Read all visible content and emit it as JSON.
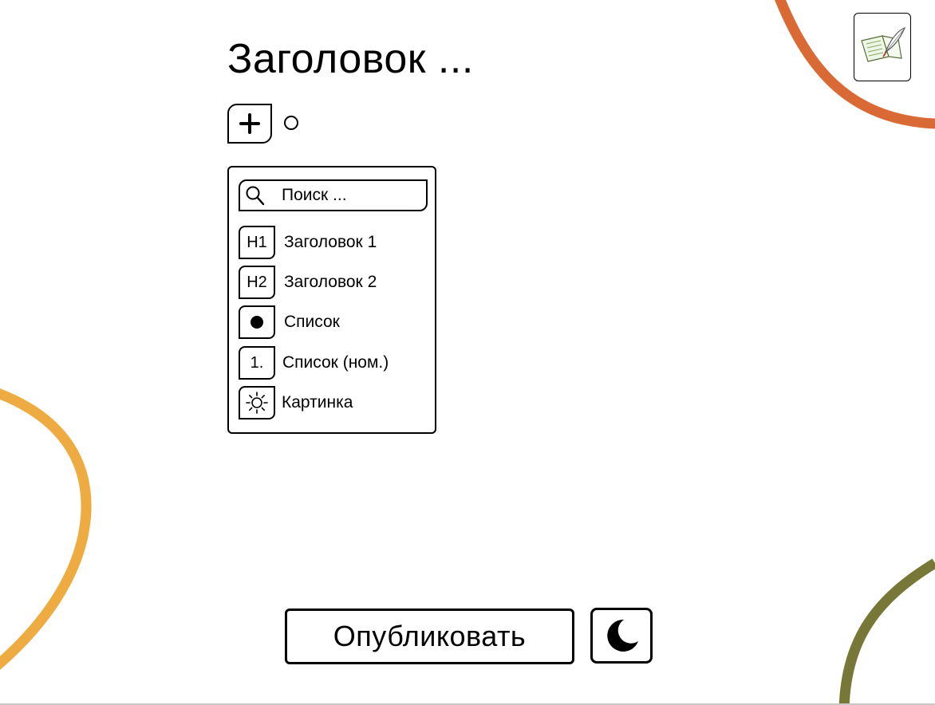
{
  "page": {
    "title": "Заголовок ..."
  },
  "toolbar": {
    "add_icon": "plus-icon",
    "status_icon": "circle-icon"
  },
  "block_menu": {
    "search": {
      "placeholder": "Поиск ...",
      "value": ""
    },
    "items": [
      {
        "icon_text": "H1",
        "label": "Заголовок 1"
      },
      {
        "icon_text": "H2",
        "label": "Заголовок 2"
      },
      {
        "icon_text": "",
        "icon": "bullet-icon",
        "label": "Список"
      },
      {
        "icon_text": "1.",
        "label": "Список (ном.)"
      },
      {
        "icon_text": "",
        "icon": "sun-icon",
        "label": "Картинка"
      }
    ]
  },
  "footer": {
    "publish_label": "Опубликовать",
    "theme_icon": "moon-icon"
  },
  "header": {
    "editor_icon": "notebook-quill-icon"
  },
  "colors": {
    "orange": "#d96a35",
    "yellow": "#eeab42",
    "olive": "#777838"
  }
}
